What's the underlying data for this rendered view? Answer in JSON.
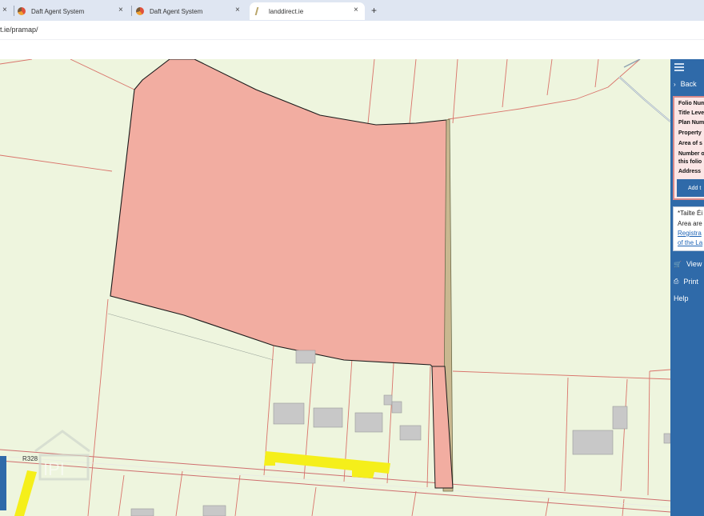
{
  "browser": {
    "tabs": [
      {
        "label": "",
        "active": false,
        "icon": "daft-icon"
      },
      {
        "label": "Daft Agent System",
        "active": false,
        "icon": "daft-icon"
      },
      {
        "label": "Daft Agent System",
        "active": false,
        "icon": "daft-icon"
      },
      {
        "label": "landdirect.ie",
        "active": true,
        "icon": "landdirect-icon"
      }
    ],
    "new_tab": "+",
    "close_glyph": "×",
    "url": "t.ie/pramap/"
  },
  "map": {
    "road_label": "R328",
    "watermark": "IPI",
    "colors": {
      "background": "#eef5de",
      "selected_parcel": "#f2ada1",
      "highlight": "#f5ef1a",
      "boundary": "#d9736a"
    }
  },
  "side_panel": {
    "back": "Back",
    "info_rows": [
      "Folio Num",
      "Title Leve",
      "Plan Num",
      "Property",
      "Area of s",
      "Number o",
      "this folio",
      "Address"
    ],
    "add_button": "Add t",
    "note_lines": [
      "*Tailte Éi",
      "Area are r",
      "Registra",
      "of the La"
    ],
    "links": [
      {
        "label": "View",
        "icon": "cart-icon"
      },
      {
        "label": "Print",
        "icon": "print-icon"
      },
      {
        "label": "Help",
        "icon": ""
      }
    ],
    "accent": "#2f6aa9"
  }
}
